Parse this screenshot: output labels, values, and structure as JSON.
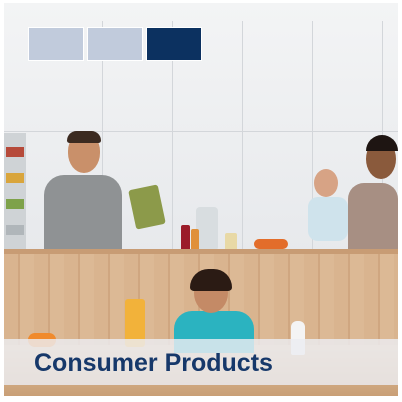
{
  "title": "Consumer Products",
  "colors": {
    "caption_text": "#16386a",
    "block_light": "#c1cbdc",
    "block_dark": "#0c3160"
  }
}
